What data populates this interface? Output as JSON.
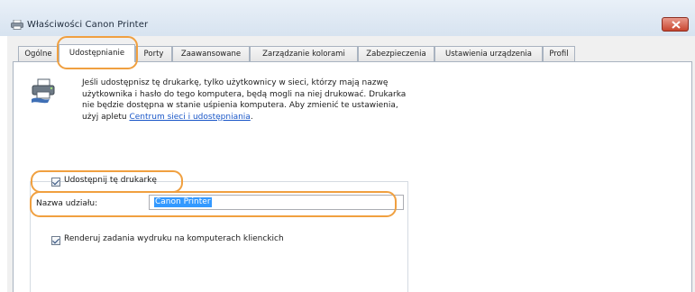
{
  "window": {
    "title": "Właściwości Canon Printer"
  },
  "tabs": [
    {
      "label": "Ogólne"
    },
    {
      "label": "Udostępnianie"
    },
    {
      "label": "Porty"
    },
    {
      "label": "Zaawansowane"
    },
    {
      "label": "Zarządzanie kolorami"
    },
    {
      "label": "Zabezpieczenia"
    },
    {
      "label": "Ustawienia urządzenia"
    },
    {
      "label": "Profil"
    }
  ],
  "active_tab": "Udostępnianie",
  "description": {
    "text": "Jeśli udostępnisz tę drukarkę, tylko użytkownicy w sieci, którzy mają nazwę użytkownika i hasło do tego komputera, będą mogli na niej drukować. Drukarka nie będzie dostępna w stanie uśpienia komputera. Aby zmienić te ustawienia, użyj apletu ",
    "link": "Centrum sieci i udostępniania",
    "suffix": "."
  },
  "share": {
    "label": "Udostępnij tę drukarkę",
    "checked": true
  },
  "share_name": {
    "label": "Nazwa udziału:",
    "value": "Canon Printer"
  },
  "render": {
    "label": "Renderuj zadania wydruku na komputerach klienckich",
    "checked": true
  },
  "colors": {
    "highlight": "#f0a040",
    "selection": "#3399ff",
    "link": "#1a57c8"
  }
}
